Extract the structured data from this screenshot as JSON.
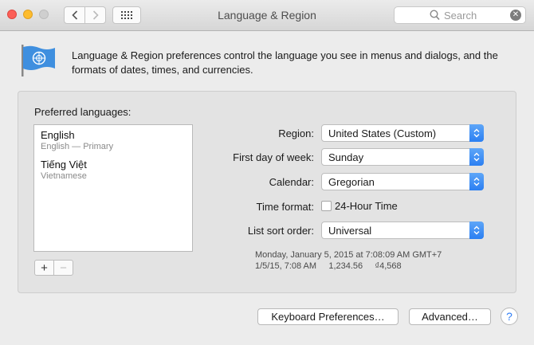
{
  "window": {
    "title": "Language & Region"
  },
  "search": {
    "placeholder": "Search"
  },
  "header": {
    "description": "Language & Region preferences control the language you see in menus and dialogs, and the formats of dates, times, and currencies."
  },
  "languages": {
    "label": "Preferred languages:",
    "items": [
      {
        "name": "English",
        "sub": "English — Primary"
      },
      {
        "name": "Tiếng Việt",
        "sub": "Vietnamese"
      }
    ],
    "add_label": "+",
    "remove_label": "−"
  },
  "fields": {
    "region": {
      "label": "Region:",
      "value": "United States (Custom)"
    },
    "first_day": {
      "label": "First day of week:",
      "value": "Sunday"
    },
    "calendar": {
      "label": "Calendar:",
      "value": "Gregorian"
    },
    "time_format": {
      "label": "Time format:",
      "checkbox_label": "24-Hour Time",
      "checked": false
    },
    "sort_order": {
      "label": "List sort order:",
      "value": "Universal"
    }
  },
  "sample": {
    "line1": "Monday, January 5, 2015 at 7:08:09 AM GMT+7",
    "line2": "1/5/15, 7:08 AM     1,234.56     ₫4,568"
  },
  "buttons": {
    "keyboard": "Keyboard Preferences…",
    "advanced": "Advanced…",
    "help": "?"
  },
  "colors": {
    "accent": "#2b7ff2",
    "close": "#fc5f57",
    "minimize": "#fdbc2e"
  }
}
